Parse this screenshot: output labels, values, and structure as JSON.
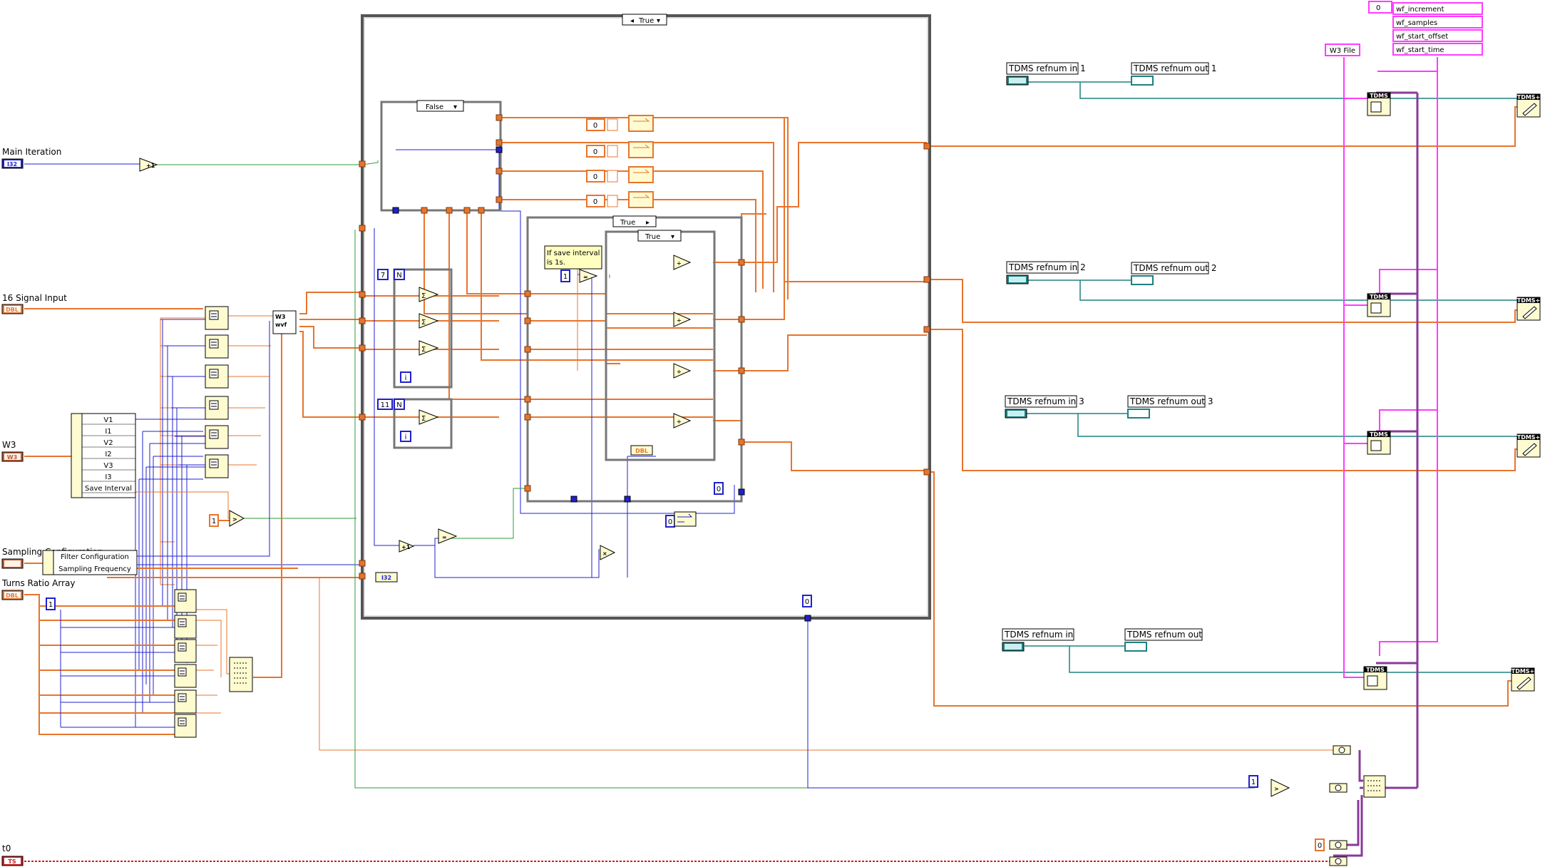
{
  "labels": {
    "main_iteration": "Main Iteration",
    "signal_input": "16 Signal Input",
    "w3": "W3",
    "sampling_config": "Sampling Configuration",
    "turns_ratio": "Turns Ratio Array",
    "t0": "t0",
    "w3_file": "W3 File",
    "comment": [
      "If save interval",
      "is 1s."
    ]
  },
  "terminal_types": {
    "i32": "I32",
    "dbl": "DBL",
    "ts": "TS",
    "w3": "W3"
  },
  "case_selectors": {
    "outer": "True",
    "inner_false": "False",
    "inner_true_a": "True",
    "inner_true_b": "True"
  },
  "constants": {
    "seven": "7",
    "eleven": "11",
    "one_a": "1",
    "one_b": "1",
    "one_c": "1",
    "one_d": "1",
    "zero_a": "0",
    "zero_b": "0",
    "zero_c": "0",
    "zero_d": "0",
    "zero_e": "0",
    "zero_top": "0",
    "zero_init": "0",
    "n": "N",
    "i": "i"
  },
  "cluster_fields": [
    "V1",
    "I1",
    "V2",
    "I2",
    "V3",
    "I3",
    "Save Interval"
  ],
  "sampling_fields": [
    "Filter Configuration",
    "Sampling Frequency"
  ],
  "waveform_attrs": [
    "wf_increment",
    "wf_samples",
    "wf_start_offset",
    "wf_start_time"
  ],
  "tdms": {
    "refnum_in": [
      "TDMS refnum in 1",
      "TDMS refnum in 2",
      "TDMS refnum in 3",
      "TDMS refnum in"
    ],
    "refnum_out": [
      "TDMS refnum out 1",
      "TDMS refnum out 2",
      "TDMS refnum out 3",
      "TDMS refnum out"
    ],
    "node_label": "TDMS",
    "write_label": "TDMS+"
  },
  "wire_colors": {
    "orange": "#e8742c",
    "blue": "#2020d0",
    "green": "#2f9a3a",
    "teal": "#1f8080",
    "pink": "#ff3cff",
    "purple": "#8a3a98",
    "red": "#d02020"
  }
}
